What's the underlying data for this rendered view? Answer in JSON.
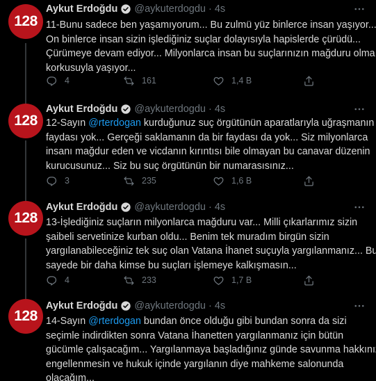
{
  "author": {
    "name": "Aykut Erdoğdu",
    "handle": "@aykuterdogdu",
    "avatar_text": "128",
    "avatar_color": "#b8141c"
  },
  "colors": {
    "link": "#1d9bf0",
    "muted": "#6e767d",
    "text": "#d9d9d9"
  },
  "tweets": [
    {
      "time": "4s",
      "lines": [
        [
          "11-Bunu sadece ben yaşamıyorum... Bu zulmü yüz binlerce insan yaşıyor..."
        ],
        [
          "On binlerce insan sizin işlediğiniz suçlar dolayısıyla hapislerde çürüdü..."
        ],
        [
          "Çürümeye devam ediyor... Milyonlarca insan bu suçlarınızın mağduru olma"
        ],
        [
          "korkusuyla yaşıyor..."
        ]
      ],
      "replies": "4",
      "retweets": "161",
      "likes": "1,4 B"
    },
    {
      "time": "4s",
      "lines": [
        [
          "12-Sayın ",
          "@rterdogan",
          " kurduğunuz suç örgütünün aparatlarıyla uğraşmanın"
        ],
        [
          "faydası yok... Gerçeği saklamanın da bir faydası da yok... Siz milyonlarca"
        ],
        [
          "insanı mağdur eden ve vicdanın kırıntısı bile olmayan bu canavar düzenin"
        ],
        [
          "kurucusunuz... Siz bu suç örgütünün bir numarasısınız..."
        ]
      ],
      "replies": "3",
      "retweets": "235",
      "likes": "1,6 B"
    },
    {
      "time": "4s",
      "lines": [
        [
          "13-İşlediğiniz suçların milyonlarca mağduru var... Milli çıkarlarımız sizin"
        ],
        [
          "şaibeli servetinize kurban oldu... Benim tek muradım birgün sizin"
        ],
        [
          "yargılanabileceğiniz tek suç olan Vatana İhanet suçuyla yargılanmanız... Bu"
        ],
        [
          "sayede bir daha kimse bu suçları işlemeye kalkışmasın..."
        ]
      ],
      "replies": "4",
      "retweets": "233",
      "likes": "1,7 B"
    },
    {
      "time": "4s",
      "lines": [
        [
          "14-Sayın ",
          "@rterdogan",
          " bundan önce olduğu gibi bundan sonra da sizi"
        ],
        [
          "seçimle indirdikten sonra Vatana İhanetten yargılanmanız için bütün"
        ],
        [
          "gücümle çalışacağım... Yargılanmaya başladığınız günde savunma hakkınız"
        ],
        [
          "engellenmesin ve hukuk içinde yargılanın diye mahkeme salonunda"
        ],
        [
          "olacağım..."
        ]
      ],
      "replies": "",
      "retweets": "",
      "likes": ""
    }
  ]
}
